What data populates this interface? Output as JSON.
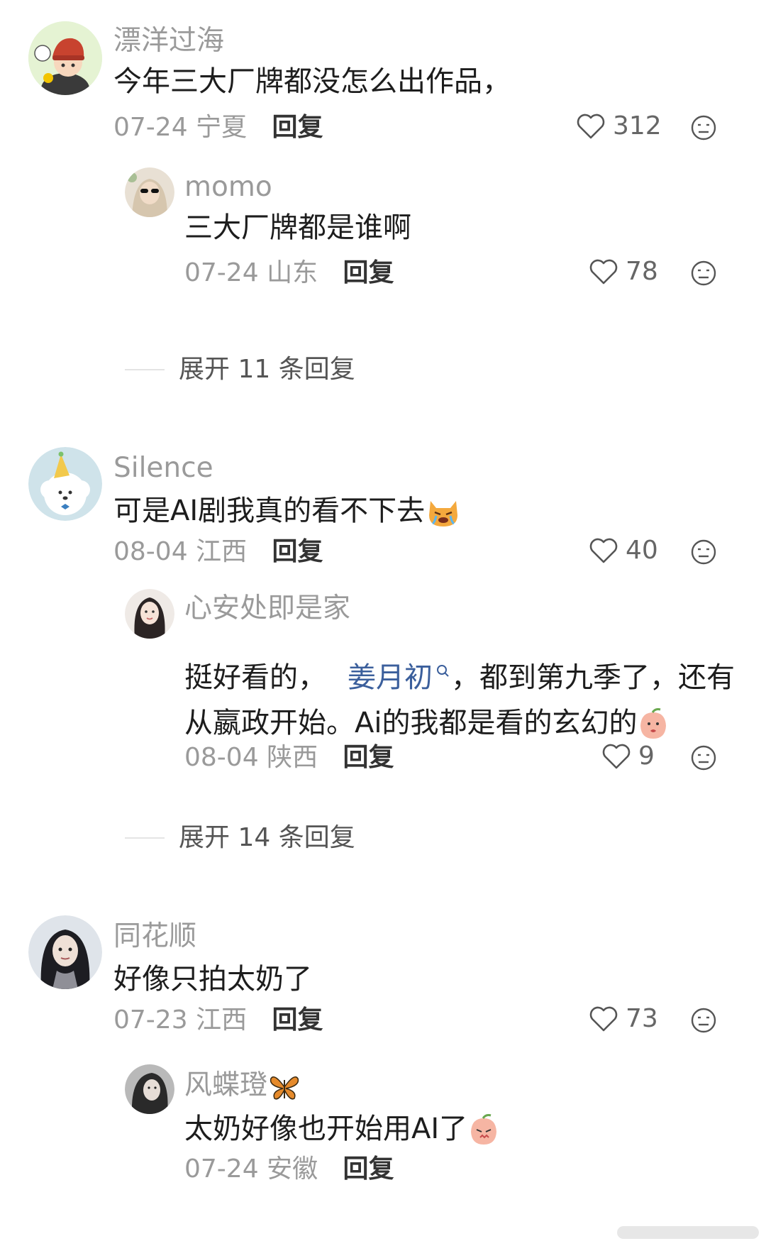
{
  "comments": [
    {
      "name": "漂洋过海",
      "text": "今年三大厂牌都没怎么出作品，",
      "date": "07-24",
      "location": "宁夏",
      "reply_label": "回复",
      "likes": "312",
      "avatar_icon": "boy-red-hat-avatar",
      "replies": [
        {
          "name": "momo",
          "text": "三大厂牌都是谁啊",
          "date": "07-24",
          "location": "山东",
          "reply_label": "回复",
          "likes": "78",
          "avatar_icon": "sunglasses-avatar"
        }
      ],
      "expand_label": "展开 11 条回复"
    },
    {
      "name": "Silence",
      "text": "可是AI剧我真的看不下去",
      "text_emoji": "crying-cat-emoji",
      "date": "08-04",
      "location": "江西",
      "reply_label": "回复",
      "likes": "40",
      "avatar_icon": "poodle-party-hat-avatar",
      "replies": [
        {
          "name": "心安处即是家",
          "text_part1": "挺好看的，",
          "mention": "姜月初",
          "text_part2": "，都到第九季了，还有",
          "text_line2": "从嬴政开始。Ai的我都是看的玄幻的",
          "text_emoji": "peach-face-emoji",
          "date": "08-04",
          "location": "陕西",
          "reply_label": "回复",
          "likes": "9",
          "avatar_icon": "girl-portrait-avatar"
        }
      ],
      "expand_label": "展开 14 条回复"
    },
    {
      "name": "同花顺",
      "text": "好像只拍太奶了",
      "date": "07-23",
      "location": "江西",
      "reply_label": "回复",
      "likes": "73",
      "avatar_icon": "woman-photo-avatar",
      "replies": [
        {
          "name": "风蝶璒",
          "name_emoji": "butterfly-emoji",
          "text": "太奶好像也开始用AI了",
          "text_emoji": "peach-blush-emoji",
          "date": "07-24",
          "location": "安徽",
          "reply_label": "回复",
          "avatar_icon": "woman-dark-photo-avatar"
        }
      ]
    }
  ],
  "colors": {
    "name": "#9a9a9a",
    "text": "#1d1d1d",
    "mention": "#3b5f9c",
    "background": "#ffffff"
  }
}
